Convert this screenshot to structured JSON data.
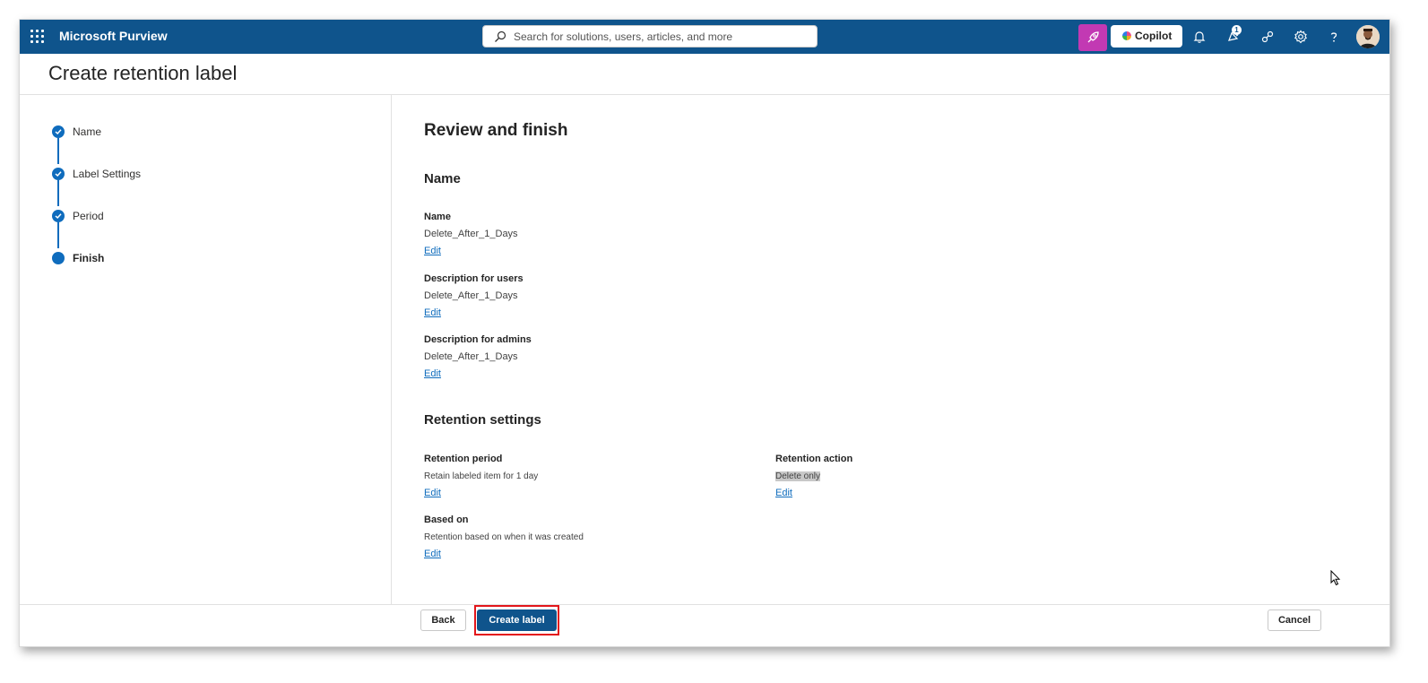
{
  "header": {
    "app_name": "Microsoft Purview",
    "search_placeholder": "Search for solutions, users, articles, and more",
    "copilot_label": "Copilot",
    "notification_badge": "1"
  },
  "page": {
    "title": "Create retention label"
  },
  "steps": [
    {
      "label": "Name",
      "state": "done"
    },
    {
      "label": "Label Settings",
      "state": "done"
    },
    {
      "label": "Period",
      "state": "done"
    },
    {
      "label": "Finish",
      "state": "current"
    }
  ],
  "review": {
    "heading": "Review and finish",
    "name_section": {
      "title": "Name",
      "name_label": "Name",
      "name_value": "Delete_After_1_Days",
      "desc_users_label": "Description for users",
      "desc_users_value": "Delete_After_1_Days",
      "desc_admins_label": "Description for admins",
      "desc_admins_value": "Delete_After_1_Days"
    },
    "retention_section": {
      "title": "Retention settings",
      "period_label": "Retention period",
      "period_value": "Retain labeled item for 1 day",
      "action_label": "Retention action",
      "action_value": "Delete only",
      "based_on_label": "Based on",
      "based_on_value": "Retention based on when it was created"
    },
    "edit_label": "Edit"
  },
  "footer": {
    "back_label": "Back",
    "create_label": "Create label",
    "cancel_label": "Cancel"
  },
  "colors": {
    "topbar": "#0f548c",
    "accent": "#0f6cbd",
    "copilot_button": "#c239b3",
    "highlight_box": "#e3161b"
  }
}
